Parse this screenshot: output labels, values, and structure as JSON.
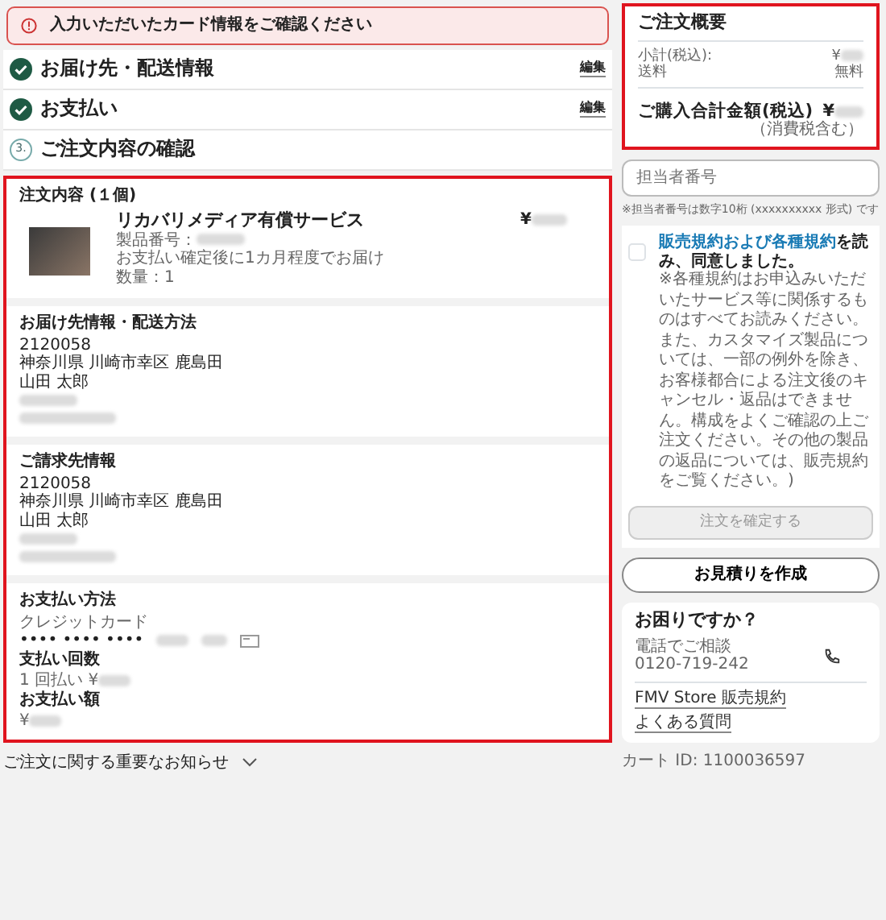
{
  "alert": {
    "text": "入力いただいたカード情報をご確認ください"
  },
  "steps": [
    {
      "kind": "done",
      "label": "お届け先・配送情報",
      "edit": "編集"
    },
    {
      "kind": "done",
      "label": "お支払い",
      "edit": "編集"
    },
    {
      "kind": "current",
      "number": "3.",
      "label": "ご注文内容の確認"
    }
  ],
  "details": {
    "highlighted": true,
    "order": {
      "title": "注文内容 (１個)",
      "item": {
        "name": "リカバリメディア有償サービス",
        "product_no_label": "製品番号：",
        "note": "お支払い確定後に1カ月程度でお届け",
        "quantity": "数量：1",
        "price": "¥"
      }
    },
    "delivery": {
      "title": "お届け先情報・配送方法",
      "lines": [
        "2120058",
        "神奈川県 川崎市幸区 鹿島田",
        "山田 太郎"
      ]
    },
    "billing": {
      "title": "ご請求先情報",
      "lines": [
        "2120058",
        "神奈川県 川崎市幸区 鹿島田",
        "山田 太郎"
      ]
    },
    "payment": {
      "title": "お支払い方法",
      "method": "クレジットカード",
      "card_mask": "•••• •••• ••••",
      "installments_label": "支払い回数",
      "installments": "1 回払い ¥",
      "amount_label": "お支払い額",
      "amount": "¥"
    }
  },
  "notice": {
    "label": "ご注文に関する重要なお知らせ",
    "expanded": false
  },
  "summary": {
    "highlighted": true,
    "title": "ご注文概要",
    "rows": [
      {
        "label": "小計(税込):",
        "value": "¥"
      },
      {
        "label": "送料",
        "value": "無料"
      }
    ],
    "total_label": "ご購入合計金額(税込)",
    "total_value": "¥",
    "tax_note": "（消費税含む）"
  },
  "staff_field": {
    "placeholder": "担当者番号",
    "hint": "※担当者番号は数字10桁 (xxxxxxxxxx 形式) です"
  },
  "terms": {
    "checked": false,
    "link": "販売規約および各種規約",
    "text": "を読み、同意しました。",
    "note": "※各種規約はお申込みいただいたサービス等に関係するものはすべてお読みください。また、カスタマイズ製品については、一部の例外を除き、お客様都合による注文後のキャンセル・返品はできません。構成をよくご確認の上ご注文ください。その他の製品の返品については、販売規約をご覧ください。)",
    "confirm_button": {
      "label": "注文を確定する",
      "disabled": true
    }
  },
  "quote_button": {
    "label": "お見積りを作成"
  },
  "help": {
    "title": "お困りですか？",
    "phone_label": "電話でご相談",
    "phone": "0120-719-242",
    "links": [
      "FMV Store 販売規約",
      "よくある質問"
    ]
  },
  "cart_id": "カート ID: 1100036597"
}
